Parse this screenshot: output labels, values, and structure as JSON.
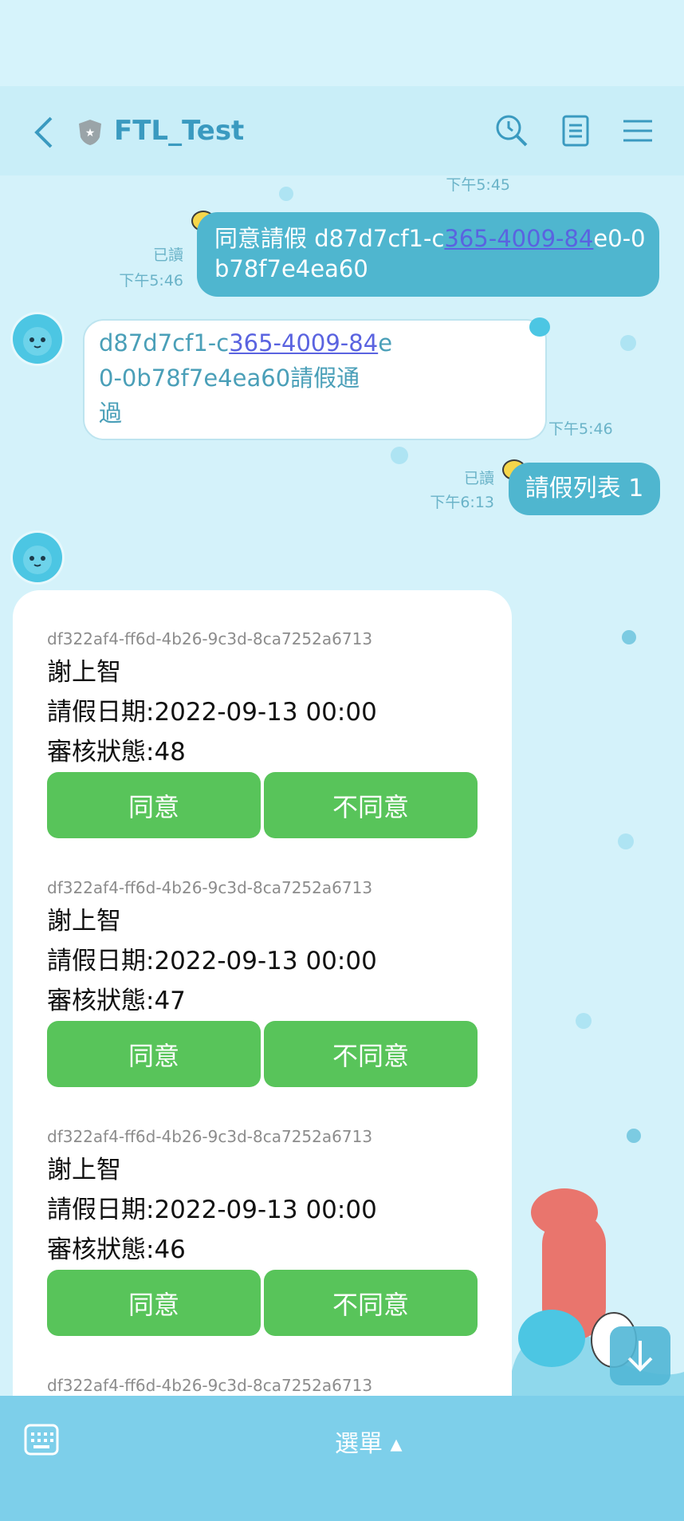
{
  "header": {
    "title": "FTL_Test",
    "icons": [
      "back-arrow-icon",
      "shield-icon",
      "search-icon",
      "notes-icon",
      "menu-icon"
    ]
  },
  "chat": {
    "top_time": "下午5:45",
    "msg1": {
      "text_a": "同意請假 d87d7cf1-c",
      "text_link": "365-4009-84",
      "text_b": "e0-0",
      "text_c": "b78f7e4ea60",
      "read": "已讀",
      "time": "下午5:46"
    },
    "msg2": {
      "text_a": "d87d7cf1-c",
      "text_link": "365-4009-84",
      "text_b": "e",
      "text_c": "0-0b78f7e4ea60請假通",
      "text_d": "過",
      "time": "下午5:46"
    },
    "msg3": {
      "text": "請假列表 1",
      "read": "已讀",
      "time": "下午6:13"
    },
    "leave_items": [
      {
        "uid": "df322af4-ff6d-4b26-9c3d-8ca7252a6713",
        "name": "謝上智",
        "date": "請假日期:2022-09-13 00:00",
        "status": "審核狀態:48",
        "agree": "同意",
        "disagree": "不同意"
      },
      {
        "uid": "df322af4-ff6d-4b26-9c3d-8ca7252a6713",
        "name": "謝上智",
        "date": "請假日期:2022-09-13 00:00",
        "status": "審核狀態:47",
        "agree": "同意",
        "disagree": "不同意"
      },
      {
        "uid": "df322af4-ff6d-4b26-9c3d-8ca7252a6713",
        "name": "謝上智",
        "date": "請假日期:2022-09-13 00:00",
        "status": "審核狀態:46",
        "agree": "同意",
        "disagree": "不同意"
      },
      {
        "uid": "df322af4-ff6d-4b26-9c3d-8ca7252a6713"
      }
    ]
  },
  "bottom": {
    "menu_label": "選單 ▴"
  },
  "colors": {
    "accent": "#4fb6cf",
    "button_green": "#58c45a",
    "bottom_bar": "#7dcfea"
  }
}
